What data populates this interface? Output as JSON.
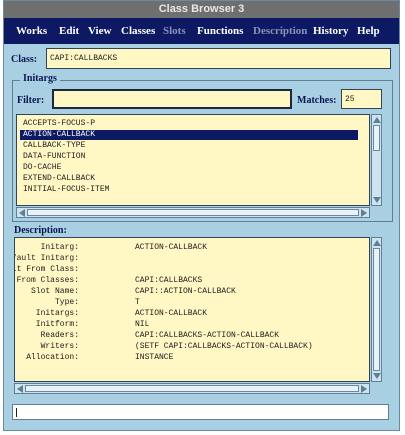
{
  "window": {
    "title": "Class Browser 3"
  },
  "menubar": {
    "items": [
      {
        "label": "Works",
        "enabled": true
      },
      {
        "label": "Edit",
        "enabled": true
      },
      {
        "label": "View",
        "enabled": true
      },
      {
        "label": "Classes",
        "enabled": true
      },
      {
        "label": "Slots",
        "enabled": false
      },
      {
        "label": "Functions",
        "enabled": true
      },
      {
        "label": "Description",
        "enabled": false
      },
      {
        "label": "History",
        "enabled": true
      },
      {
        "label": "Help",
        "enabled": true
      }
    ]
  },
  "class_row": {
    "label": "Class:",
    "value": "CAPI:CALLBACKS"
  },
  "initargs": {
    "group_title": "Initargs",
    "filter_label": "Filter:",
    "filter_value": "",
    "matches_label": "Matches:",
    "matches_value": "25",
    "items": [
      {
        "text": "ACCEPTS-FOCUS-P",
        "selected": false
      },
      {
        "text": "ACTION-CALLBACK",
        "selected": true
      },
      {
        "text": "CALLBACK-TYPE",
        "selected": false
      },
      {
        "text": "DATA-FUNCTION",
        "selected": false
      },
      {
        "text": "DO-CACHE",
        "selected": false
      },
      {
        "text": "EXTEND-CALLBACK",
        "selected": false
      },
      {
        "text": "INITIAL-FOCUS-ITEM",
        "selected": false
      }
    ]
  },
  "description": {
    "label": "Description:",
    "rows": [
      {
        "label": "Initarg:",
        "value": "ACTION-CALLBACK"
      },
      {
        "label": "Default Initarg:",
        "value": ""
      },
      {
        "label": "Default From Class:",
        "value": ""
      },
      {
        "label": "From Classes:",
        "value": "CAPI:CALLBACKS"
      },
      {
        "label": "Slot Name:",
        "value": "CAPI::ACTION-CALLBACK"
      },
      {
        "label": "Type:",
        "value": "T"
      },
      {
        "label": "Initargs:",
        "value": "ACTION-CALLBACK"
      },
      {
        "label": "Initform:",
        "value": "NIL"
      },
      {
        "label": "Readers:",
        "value": "CAPI:CALLBACKS-ACTION-CALLBACK"
      },
      {
        "label": "Writers:",
        "value": "(SETF CAPI:CALLBACKS-ACTION-CALLBACK)"
      },
      {
        "label": "Allocation:",
        "value": "INSTANCE"
      }
    ]
  },
  "status": {
    "text": ""
  },
  "colors": {
    "window_bg": "#a9cfe3",
    "menubar_bg": "#0d1a63",
    "field_bg": "#fff7c4",
    "selection_bg": "#0d1a63"
  }
}
